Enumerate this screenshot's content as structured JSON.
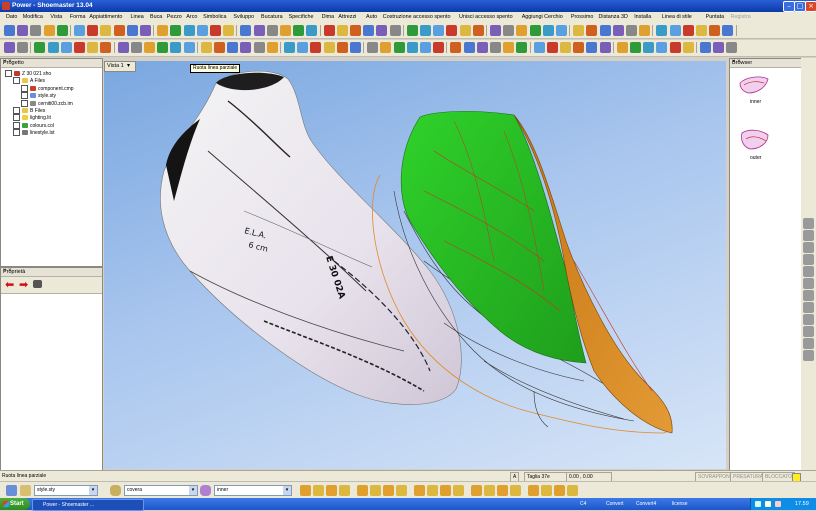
{
  "window": {
    "title": "Power - Shoemaster 13.04"
  },
  "menu": [
    "Dato",
    "Modifica",
    "Vista",
    "Forma",
    "Appiattimento",
    "Linea",
    "Buca",
    "Pezzo",
    "Arco",
    "Simbolica",
    "Sviluppo",
    "Bucatura",
    "Specifiche",
    "Dima",
    "Attrezzi",
    "Auto",
    "Costruzione accesso spento",
    "Unisci accesso spento",
    "Aggiungi Cerchio",
    "Prossimo",
    "Distanza 3D",
    "Installa",
    "Linea di stile",
    "Puntata",
    "Registra"
  ],
  "menu_disabled_last": true,
  "project_panel": {
    "title": "Progetto",
    "tree": [
      {
        "label": "Z 30 021 sho",
        "level": 0,
        "icon": "shoe-icon"
      },
      {
        "label": "A Files",
        "level": 1,
        "icon": "folder-icon"
      },
      {
        "label": "component.cmp",
        "level": 2,
        "icon": "component-icon"
      },
      {
        "label": "style.sty",
        "level": 2,
        "icon": "style-icon"
      },
      {
        "label": "cerniti00.zcb.im",
        "level": 2,
        "icon": "file-icon"
      },
      {
        "label": "B Files",
        "level": 1,
        "icon": "folder-icon"
      },
      {
        "label": "lighting.lit",
        "level": 1,
        "icon": "bulb-icon"
      },
      {
        "label": "colours.col",
        "level": 1,
        "icon": "palette-icon"
      },
      {
        "label": "linestyle.lst",
        "level": 1,
        "icon": "linestyle-icon"
      }
    ]
  },
  "properties_panel": {
    "title": "Proprietà"
  },
  "viewport": {
    "tab_label": "Vista 1",
    "tooltip": "Ruota linea parziale"
  },
  "model_text": {
    "line1": "E.L.A.",
    "line2": "6 cm",
    "line3": "E 30 02A"
  },
  "browser": {
    "title": "Browser",
    "items": [
      {
        "label": "inner"
      },
      {
        "label": "outer"
      }
    ]
  },
  "status": {
    "message": "Ruota linea parziale",
    "mode": "A",
    "size": "Taglia 37e",
    "coords": "0.00 , 0.00",
    "flags": [
      "SOVRAPPONE",
      "PRESATURA",
      "BLOCCATO"
    ]
  },
  "bottom_toolbar": {
    "style_value": "style.sty",
    "combo1_value": "covera",
    "combo2_value": "inner"
  },
  "taskbar": {
    "start": "Start",
    "app": "Power - Shoemaster ...",
    "items": [
      "C4",
      "Convert",
      "Convert4",
      "license"
    ],
    "time": "17.59"
  },
  "colors": {
    "green": "#2fb82a",
    "orange": "#d07a1a",
    "title_blue": "#0b3aa8"
  }
}
